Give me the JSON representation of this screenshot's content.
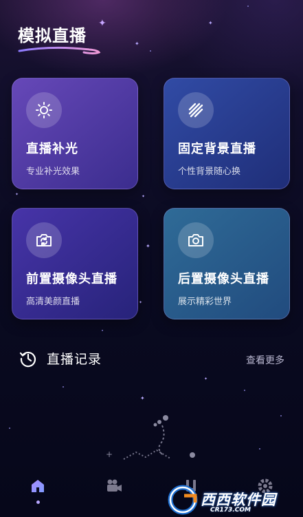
{
  "header": {
    "title": "模拟直播"
  },
  "cards": [
    {
      "title": "直播补光",
      "subtitle": "专业补光效果",
      "icon": "sun-icon"
    },
    {
      "title": "固定背景直播",
      "subtitle": "个性背景随心换",
      "icon": "stripes-icon"
    },
    {
      "title": "前置摄像头直播",
      "subtitle": "高清美颜直播",
      "icon": "camera-switch-icon"
    },
    {
      "title": "后置摄像头直播",
      "subtitle": "展示精彩世界",
      "icon": "camera-icon"
    }
  ],
  "history": {
    "label": "直播记录",
    "more": "查看更多",
    "icon": "history-clock-icon"
  },
  "tabbar": {
    "tabs": [
      {
        "name": "home",
        "icon": "home-icon",
        "active": true
      },
      {
        "name": "video",
        "icon": "video-camera-icon",
        "active": false
      },
      {
        "name": "tools",
        "icon": "tools-icon",
        "active": false
      },
      {
        "name": "settings",
        "icon": "gear-icon",
        "active": false
      }
    ]
  },
  "watermark": {
    "text": "西西软件园",
    "domain": "CR173.COM"
  },
  "colors": {
    "accent": "#b7a6ff",
    "background": "#0b0b22"
  }
}
